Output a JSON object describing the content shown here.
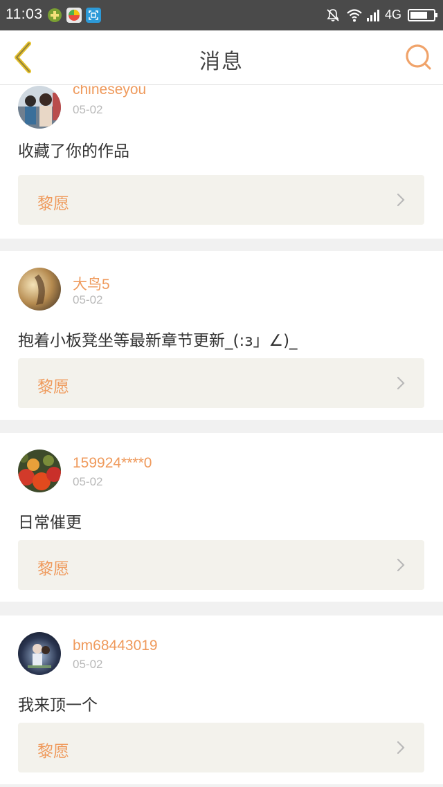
{
  "status_bar": {
    "time": "11:03",
    "network": "4G"
  },
  "header": {
    "title": "消息"
  },
  "colors": {
    "accent": "#ef9a5c",
    "back_icon": "#e8c22a",
    "search_icon": "#f0a36a"
  },
  "messages": [
    {
      "username": "chineseyou",
      "date": "05-02",
      "text": "收藏了你的作品",
      "work": "黎愿"
    },
    {
      "username": "大鸟5",
      "date": "05-02",
      "text": "抱着小板凳坐等最新章节更新_(:з」∠)_",
      "work": "黎愿"
    },
    {
      "username": "159924****0",
      "date": "05-02",
      "text": "日常催更",
      "work": "黎愿"
    },
    {
      "username": "bm68443019",
      "date": "05-02",
      "text": "我来顶一个",
      "work": "黎愿"
    }
  ]
}
